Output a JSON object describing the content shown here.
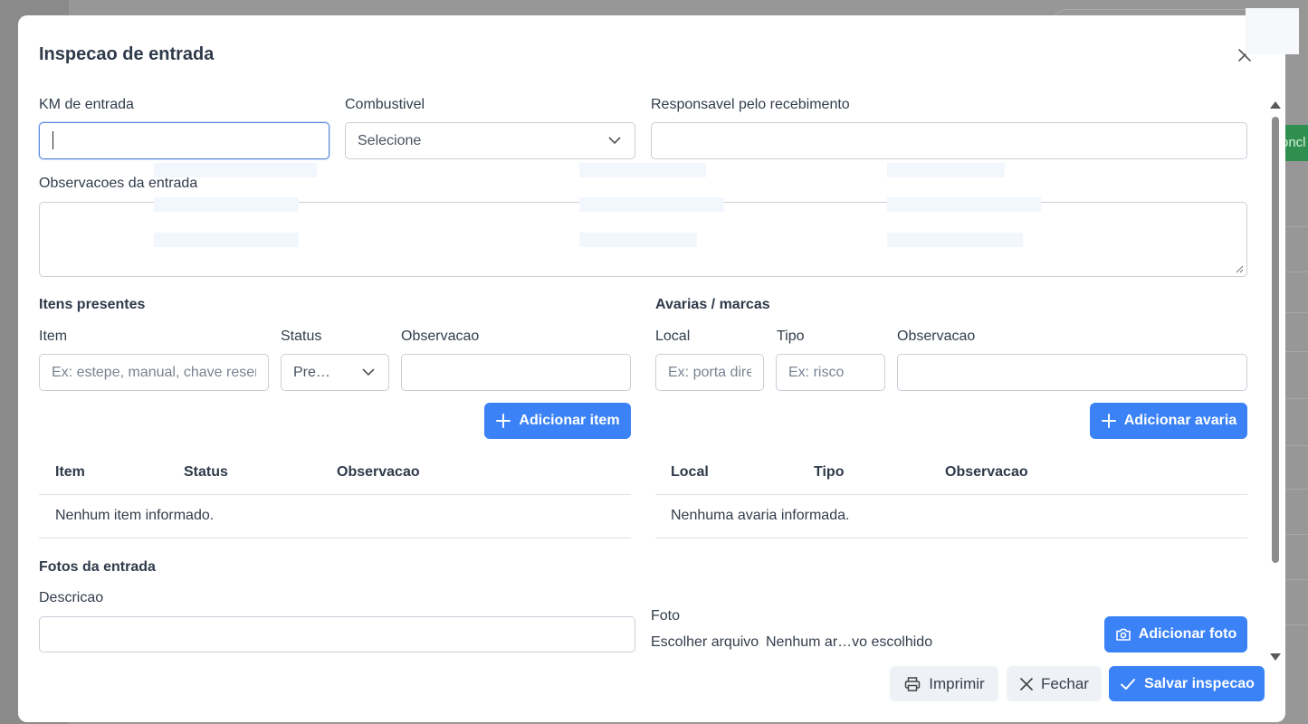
{
  "background": {
    "green_button_label": "oncl"
  },
  "modal": {
    "title": "Inspecao de entrada",
    "km": {
      "label": "KM de entrada",
      "value": ""
    },
    "combustivel": {
      "label": "Combustivel",
      "selected": "Selecione"
    },
    "responsavel": {
      "label": "Responsavel pelo recebimento",
      "value": ""
    },
    "observacoes": {
      "label": "Observacoes da entrada",
      "value": ""
    },
    "itens": {
      "section_title": "Itens presentes",
      "item_label": "Item",
      "item_placeholder": "Ex: estepe, manual, chave reserva",
      "status_label": "Status",
      "status_selected": "Pre…",
      "obs_label": "Observacao",
      "add_button": "Adicionar item",
      "table_headers": [
        "Item",
        "Status",
        "Observacao"
      ],
      "empty_text": "Nenhum item informado."
    },
    "avarias": {
      "section_title": "Avarias / marcas",
      "local_label": "Local",
      "local_placeholder": "Ex: porta direita",
      "tipo_label": "Tipo",
      "tipo_placeholder": "Ex: risco",
      "obs_label": "Observacao",
      "add_button": "Adicionar avaria",
      "table_headers": [
        "Local",
        "Tipo",
        "Observacao"
      ],
      "empty_text": "Nenhuma avaria informada."
    },
    "fotos": {
      "section_title": "Fotos da entrada",
      "descricao_label": "Descricao",
      "foto_label": "Foto",
      "file_button": "Escolher arquivo",
      "file_status": "Nenhum ar…vo escolhido",
      "add_button": "Adicionar foto"
    },
    "footer": {
      "print_button": "Imprimir",
      "close_button": "Fechar",
      "save_button": "Salvar inspecao"
    }
  }
}
